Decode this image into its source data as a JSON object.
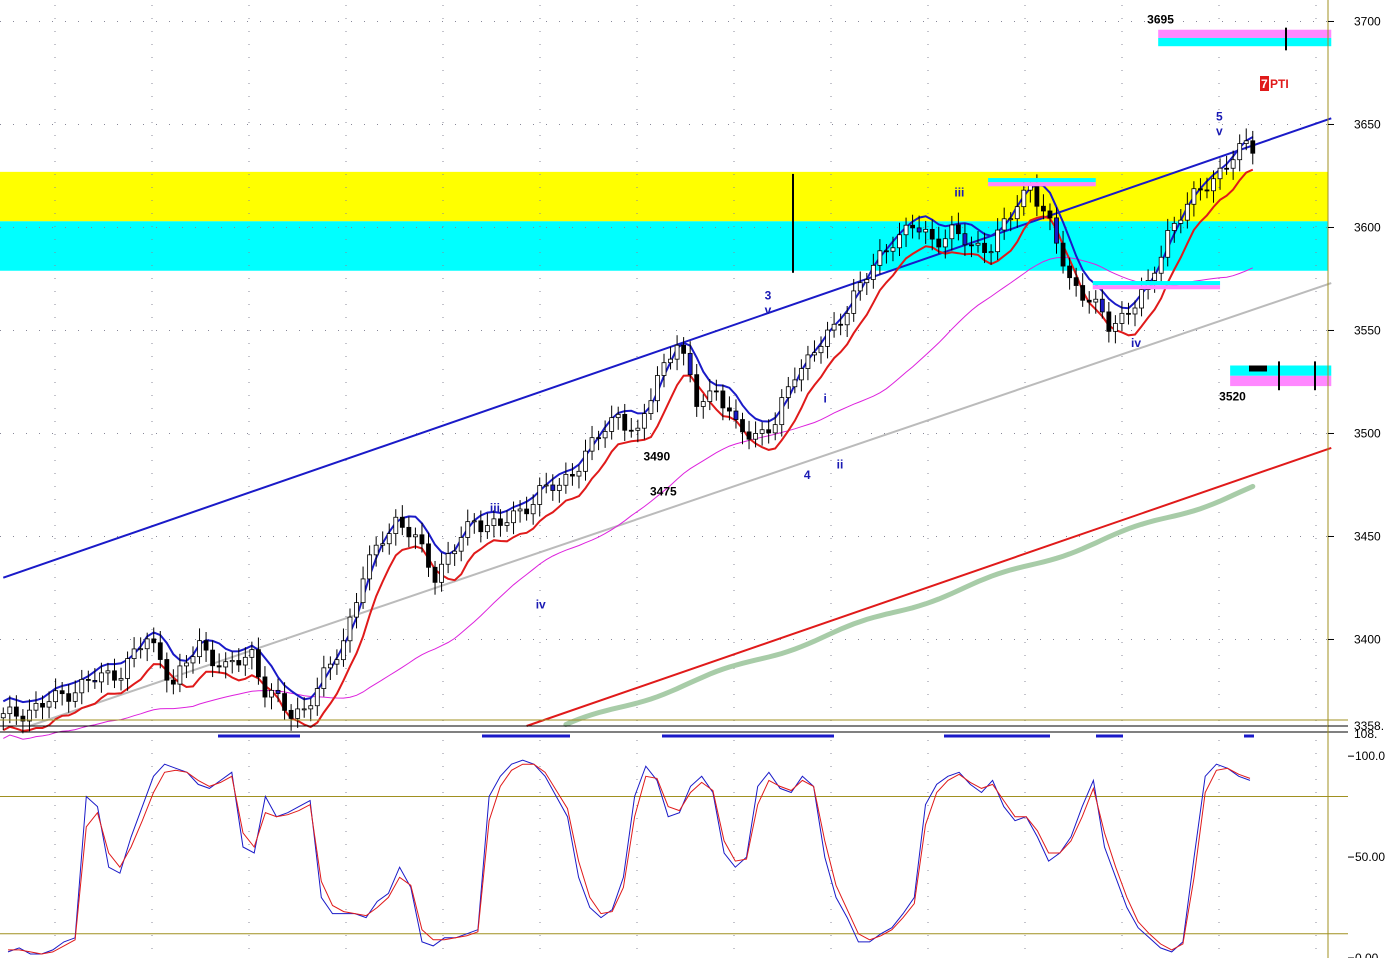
{
  "colors": {
    "bull_candle": "#ffffff",
    "bear_candle": "#000000",
    "wave_blue": "#1a1ab4",
    "band_yellow": "#ffff00",
    "band_cyan": "#00ffff",
    "band_pink": "#ff88ff",
    "channel_blue": "#1a1ac8",
    "channel_red": "#e01a1a",
    "trend_gray": "#bbbbbb",
    "ma_green": "#a8cca8",
    "ma_magenta": "#dd22dd",
    "stoch_k": "#1a1ac8",
    "stoch_d": "#e01a1a",
    "ref_line": "#a09020",
    "pti_box": "#e01a1a"
  },
  "labels": {
    "pti": "7",
    "pti_text": "PTI"
  },
  "chart_data": [
    {
      "type": "line",
      "subtype": "candlestick",
      "ylim": [
        3358,
        3708
      ],
      "y_ticks": [
        {
          "value": 3700,
          "label": "3700"
        },
        {
          "value": 3650,
          "label": "3650"
        },
        {
          "value": 3600,
          "label": "3600"
        },
        {
          "value": 3550,
          "label": "3550"
        },
        {
          "value": 3500,
          "label": "3500"
        },
        {
          "value": 3450,
          "label": "3450"
        },
        {
          "value": 3400,
          "label": "3400"
        },
        {
          "value": 3358,
          "label": "3358."
        }
      ],
      "grid": true,
      "zones": [
        {
          "name": "yellow",
          "from": 3603,
          "to": 3627
        },
        {
          "name": "cyan",
          "from": 3579,
          "to": 3603
        }
      ],
      "candles_anchor": [
        [
          0,
          3362
        ],
        [
          6,
          3368
        ],
        [
          12,
          3378
        ],
        [
          18,
          3385
        ],
        [
          22,
          3400
        ],
        [
          24,
          3392
        ],
        [
          26,
          3378
        ],
        [
          30,
          3398
        ],
        [
          34,
          3385
        ],
        [
          38,
          3394
        ],
        [
          40,
          3375
        ],
        [
          44,
          3364
        ],
        [
          46,
          3367
        ],
        [
          48,
          3375
        ],
        [
          52,
          3400
        ],
        [
          55,
          3430
        ],
        [
          58,
          3450
        ],
        [
          60,
          3458
        ],
        [
          63,
          3448
        ],
        [
          66,
          3432
        ],
        [
          69,
          3444
        ],
        [
          72,
          3458
        ],
        [
          76,
          3455
        ],
        [
          79,
          3462
        ],
        [
          82,
          3472
        ],
        [
          85,
          3474
        ],
        [
          88,
          3486
        ],
        [
          91,
          3498
        ],
        [
          94,
          3510
        ],
        [
          97,
          3498
        ],
        [
          100,
          3528
        ],
        [
          103,
          3545
        ],
        [
          106,
          3515
        ],
        [
          109,
          3522
        ],
        [
          112,
          3502
        ],
        [
          115,
          3500
        ],
        [
          118,
          3504
        ],
        [
          121,
          3530
        ],
        [
          124,
          3540
        ],
        [
          127,
          3550
        ],
        [
          130,
          3568
        ],
        [
          133,
          3580
        ],
        [
          136,
          3595
        ],
        [
          139,
          3600
        ],
        [
          142,
          3594
        ],
        [
          145,
          3598
        ],
        [
          148,
          3590
        ],
        [
          151,
          3592
        ],
        [
          154,
          3605
        ],
        [
          157,
          3622
        ],
        [
          160,
          3600
        ],
        [
          163,
          3575
        ],
        [
          166,
          3565
        ],
        [
          169,
          3552
        ],
        [
          172,
          3560
        ],
        [
          175,
          3570
        ],
        [
          178,
          3598
        ],
        [
          181,
          3610
        ],
        [
          184,
          3622
        ],
        [
          187,
          3630
        ],
        [
          190,
          3640
        ]
      ],
      "wave_labels": [
        {
          "text": "iii",
          "x": 75,
          "y": 3462
        },
        {
          "text": "iv",
          "x": 82,
          "y": 3415
        },
        {
          "text": "3",
          "x": 117,
          "y": 3565
        },
        {
          "text": "v",
          "x": 117,
          "y": 3558
        },
        {
          "text": "4",
          "x": 123,
          "y": 3478
        },
        {
          "text": "i",
          "x": 126,
          "y": 3515
        },
        {
          "text": "ii",
          "x": 128,
          "y": 3483
        },
        {
          "text": "iii",
          "x": 146,
          "y": 3615
        },
        {
          "text": "iv",
          "x": 173,
          "y": 3542
        },
        {
          "text": "5",
          "x": 186,
          "y": 3652
        },
        {
          "text": "v",
          "x": 186,
          "y": 3645
        }
      ],
      "price_labels": [
        {
          "text": "3490",
          "x": 100,
          "y": 3487
        },
        {
          "text": "3475",
          "x": 101,
          "y": 3470
        },
        {
          "text": "3695",
          "x": 177,
          "y": 3699
        },
        {
          "text": "3520",
          "x": 188,
          "y": 3516
        }
      ],
      "level_boxes": [
        {
          "x0": 177,
          "x1": 203,
          "from": 3688,
          "to": 3696,
          "top_color": "pink",
          "bottom_color": "cyan"
        },
        {
          "x0": 151,
          "x1": 167,
          "from": 3620,
          "to": 3624,
          "top_color": "cyan",
          "bottom_color": "pink"
        },
        {
          "x0": 167,
          "x1": 186,
          "from": 3570,
          "to": 3574,
          "top_color": "cyan",
          "bottom_color": "pink"
        },
        {
          "x0": 188,
          "x1": 203,
          "from": 3523,
          "to": 3533,
          "top_color": "cyan",
          "bottom_color": "pink"
        }
      ],
      "lines": [
        {
          "name": "upper channel",
          "x0": 0,
          "y0": 3430,
          "x1": 203,
          "y1": 3653
        },
        {
          "name": "lower channel",
          "x0": 80,
          "y0": 3358,
          "x1": 203,
          "y1": 3493
        },
        {
          "name": "gray trend",
          "x0": 4,
          "y0": 3358,
          "x1": 203,
          "y1": 3573
        }
      ]
    },
    {
      "type": "line",
      "subtype": "stochastic",
      "ylim": [
        0,
        108
      ],
      "y_ticks": [
        {
          "value": 100,
          "label": "100.0"
        },
        {
          "value": 50,
          "label": "50.00"
        },
        {
          "value": 0,
          "label": "0.00"
        }
      ],
      "top_label": "108.",
      "reference_lines": [
        80,
        12
      ],
      "series": [
        {
          "name": "",
          "values": [
            3,
            5,
            2,
            2,
            4,
            8,
            10,
            80,
            75,
            45,
            42,
            60,
            75,
            90,
            96,
            94,
            92,
            86,
            84,
            88,
            92,
            55,
            52,
            80,
            70,
            72,
            75,
            78,
            30,
            22,
            22,
            22,
            20,
            28,
            32,
            45,
            35,
            8,
            6,
            10,
            10,
            12,
            14,
            80,
            90,
            96,
            98,
            96,
            90,
            80,
            70,
            40,
            25,
            20,
            24,
            40,
            80,
            95,
            88,
            70,
            72,
            85,
            90,
            82,
            52,
            45,
            50,
            85,
            92,
            84,
            82,
            90,
            85,
            50,
            30,
            20,
            8,
            8,
            12,
            15,
            22,
            30,
            76,
            86,
            90,
            92,
            86,
            82,
            88,
            75,
            68,
            70,
            60,
            48,
            52,
            60,
            75,
            88,
            55,
            40,
            25,
            15,
            10,
            5,
            3,
            8,
            50,
            90,
            96,
            94,
            90,
            88
          ]
        },
        {
          "name": "",
          "values": [
            4,
            4,
            3,
            2,
            3,
            6,
            9,
            65,
            72,
            52,
            45,
            55,
            68,
            82,
            92,
            93,
            92,
            88,
            85,
            87,
            90,
            62,
            55,
            72,
            70,
            71,
            73,
            76,
            38,
            26,
            23,
            22,
            21,
            25,
            30,
            40,
            36,
            14,
            9,
            9,
            10,
            11,
            13,
            68,
            85,
            93,
            96,
            96,
            92,
            83,
            74,
            48,
            30,
            22,
            23,
            35,
            70,
            90,
            89,
            75,
            73,
            82,
            87,
            83,
            58,
            48,
            49,
            76,
            88,
            85,
            83,
            88,
            85,
            58,
            36,
            24,
            12,
            9,
            11,
            14,
            20,
            27,
            66,
            82,
            88,
            91,
            87,
            84,
            86,
            78,
            70,
            70,
            63,
            52,
            52,
            58,
            70,
            84,
            62,
            45,
            30,
            18,
            12,
            7,
            4,
            7,
            40,
            82,
            93,
            94,
            91,
            89
          ]
        }
      ]
    }
  ]
}
